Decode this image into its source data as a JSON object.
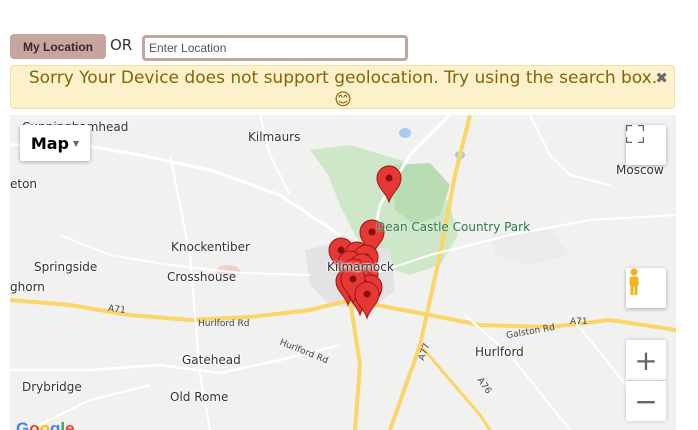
{
  "location_bar": {
    "button_label": "My Location",
    "or_text": "OR",
    "input_placeholder": "Enter Location",
    "input_value": ""
  },
  "alert": {
    "message": "Sorry Your Device does not support geolocation. Try using the search box. 😊",
    "close_symbol": "✖"
  },
  "map": {
    "type_label": "Map",
    "google_logo": "Google",
    "place_labels": [
      "Cunninghamhead",
      "Kilmaurs",
      "Moscow",
      "eton",
      "Knockentiber",
      "Springside",
      "Crosshouse",
      "ghorn",
      "Kilmarnock",
      "Hurlford",
      "Gatehead",
      "Drybridge",
      "Old Rome"
    ],
    "park_label": "Dean Castle Country Park",
    "road_labels": [
      "A71",
      "Hurlford Rd",
      "Hurlford Rd",
      "A77",
      "Galston Rd",
      "A71",
      "A76"
    ],
    "marker_color": "#e53935",
    "marker_count": 16,
    "zoom_in_symbol": "+",
    "zoom_out_symbol": "−"
  }
}
